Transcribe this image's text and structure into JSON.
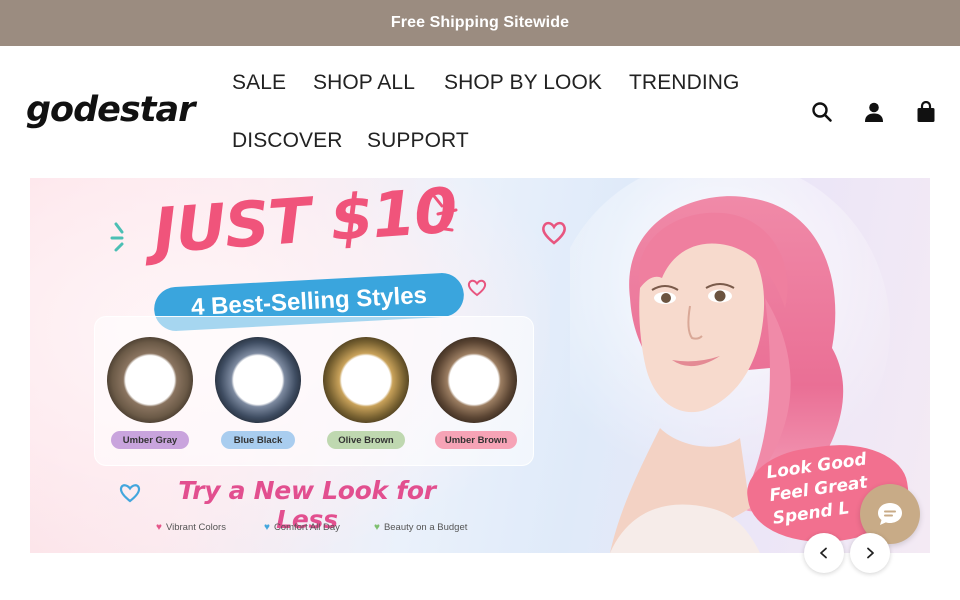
{
  "announcement": {
    "text": "Free Shipping Sitewide"
  },
  "header": {
    "logo": "godestar",
    "nav": [
      {
        "label": "SALE"
      },
      {
        "label": "SHOP ALL"
      },
      {
        "label": "SHOP BY LOOK"
      },
      {
        "label": "TRENDING"
      },
      {
        "label": "DISCOVER"
      },
      {
        "label": "SUPPORT"
      }
    ],
    "icons": [
      "search-icon",
      "account-icon",
      "cart-icon"
    ]
  },
  "hero": {
    "headline": "JUST $10",
    "subheadline": "4 Best-Selling Styles",
    "lenses": [
      {
        "name": "Umber Gray",
        "tag_color": "#c9a4dd",
        "ring_color": "#6b5a47"
      },
      {
        "name": "Blue Black",
        "tag_color": "#a9cdef",
        "ring_color": "#3f4d62"
      },
      {
        "name": "Olive Brown",
        "tag_color": "#bfd8b0",
        "ring_color": "#7a6332"
      },
      {
        "name": "Umber Brown",
        "tag_color": "#f6a3b6",
        "ring_color": "#5c4634"
      }
    ],
    "tagline": "Try a New Look for Less",
    "features": [
      {
        "label": "Vibrant Colors",
        "heart_color": "#e5568a"
      },
      {
        "label": "Comfort All Day",
        "heart_color": "#43a6dd"
      },
      {
        "label": "Beauty on a Budget",
        "heart_color": "#7ebf6f"
      }
    ],
    "sticker": {
      "line1": "Look Good",
      "line2": "Feel Great",
      "line3": "Spend L"
    }
  },
  "colors": {
    "announcement_bg": "#9b8c80",
    "chat_button": "#c8ab87",
    "headline_pink": "#f0547b",
    "pill_blue": "#3aa5dd"
  }
}
